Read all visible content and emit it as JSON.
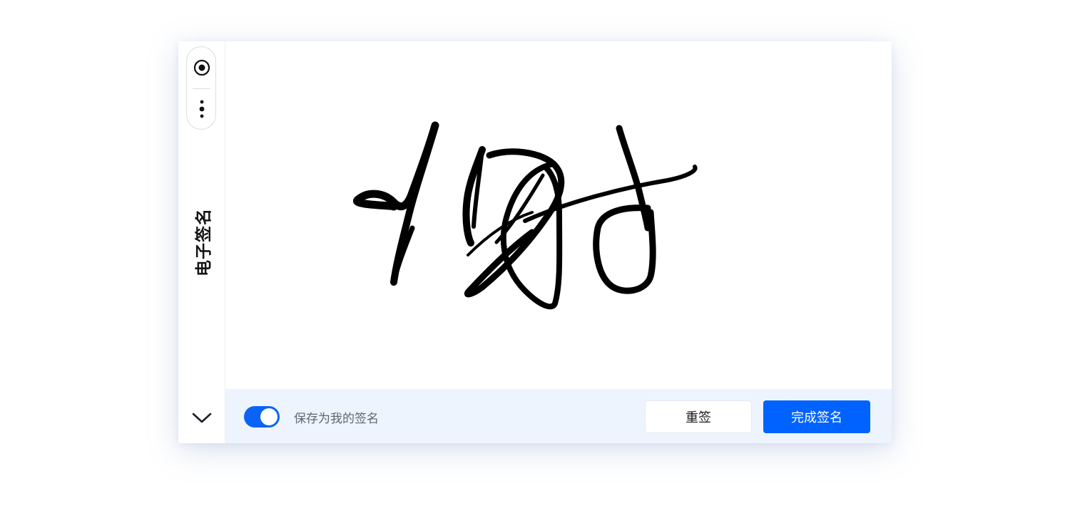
{
  "sidebar": {
    "title": "电子签名",
    "tools": [
      {
        "name": "target-icon"
      },
      {
        "name": "more-vertical-icon"
      }
    ],
    "collapse_icon": "chevron-down-icon"
  },
  "canvas": {
    "stroke_color": "#000000"
  },
  "footer": {
    "save_toggle": {
      "label": "保存为我的签名",
      "checked": true,
      "color": "#0b63f6"
    },
    "resign_label": "重签",
    "finish_label": "完成签名",
    "primary_color": "#0062ff",
    "background": "#eef4fd"
  }
}
